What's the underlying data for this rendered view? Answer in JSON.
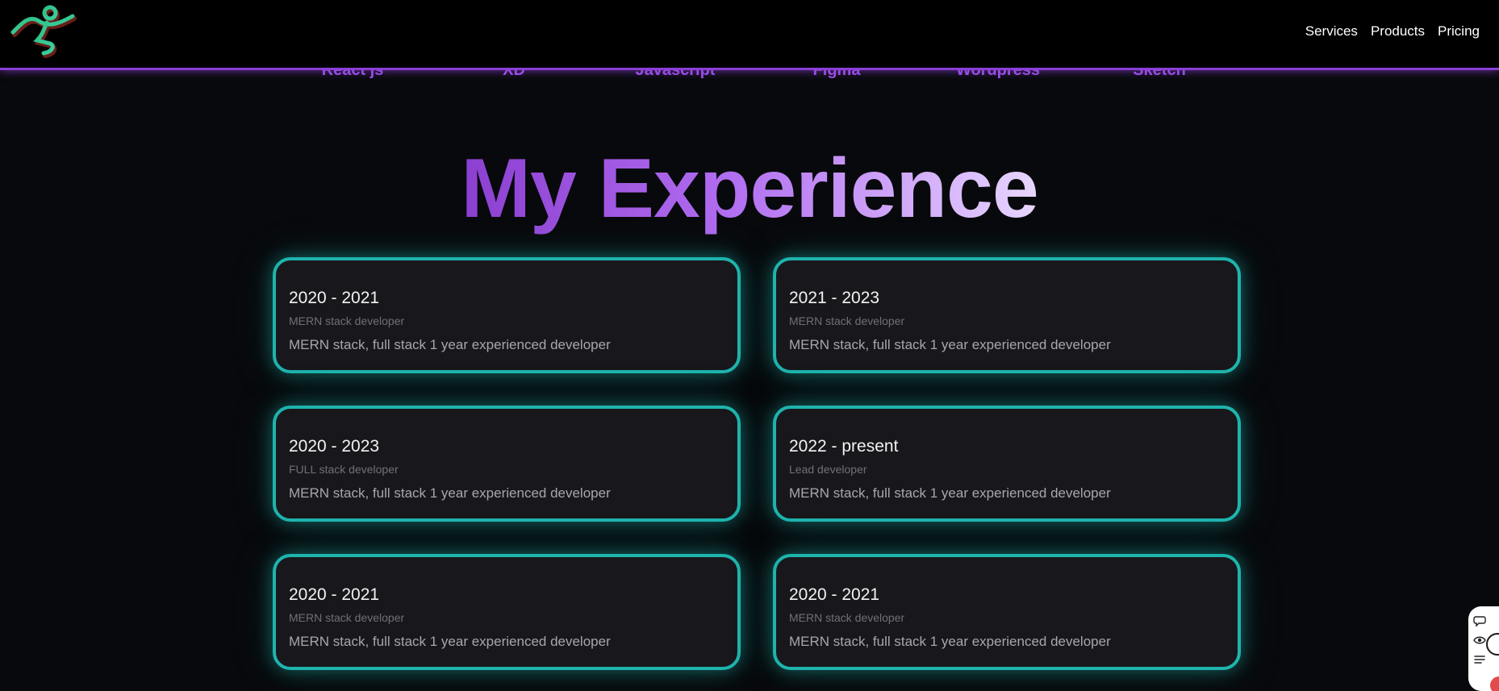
{
  "header": {
    "logo_icon": "stick-figure-logo-icon",
    "nav": [
      "Services",
      "Products",
      "Pricing"
    ]
  },
  "skills": [
    "React js",
    "XD",
    "Javascript",
    "Figma",
    "Wordpress",
    "Sketch"
  ],
  "section": {
    "title": "My Experience"
  },
  "experience": [
    {
      "period": "2020 - 2021",
      "role": "MERN stack developer",
      "desc": "MERN stack, full stack 1 year experienced developer"
    },
    {
      "period": "2021 - 2023",
      "role": "MERN stack developer",
      "desc": "MERN stack, full stack 1 year experienced developer"
    },
    {
      "period": "2020 - 2023",
      "role": "FULL stack developer",
      "desc": "MERN stack, full stack 1 year experienced developer"
    },
    {
      "period": "2022 - present",
      "role": "Lead developer",
      "desc": "MERN stack, full stack 1 year experienced developer"
    },
    {
      "period": "2020 - 2021",
      "role": "MERN stack developer",
      "desc": "MERN stack, full stack 1 year experienced developer"
    },
    {
      "period": "2020 - 2021",
      "role": "MERN stack developer",
      "desc": "MERN stack, full stack 1 year experienced developer"
    }
  ],
  "widget": {
    "icons": [
      "chat-icon",
      "eye-icon",
      "list-icon"
    ]
  },
  "colors": {
    "accent_purple": "#8a3fd6",
    "card_border": "#1fb3ad",
    "card_bg": "#18181c",
    "page_bg": "#08090c"
  }
}
